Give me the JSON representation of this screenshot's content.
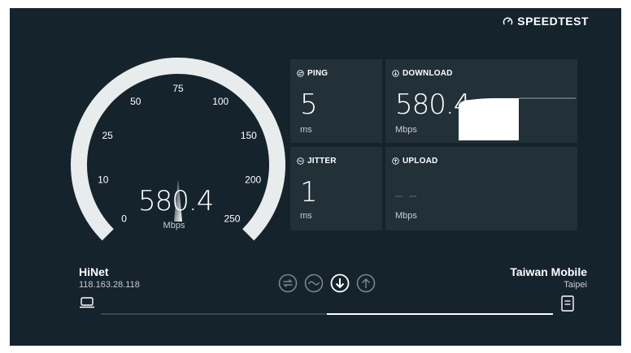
{
  "brand": {
    "name": "SPEEDTEST",
    "icon": "speedometer-icon"
  },
  "gauge": {
    "ticks": [
      "0",
      "10",
      "25",
      "50",
      "75",
      "100",
      "150",
      "200",
      "250"
    ],
    "needle_value": 75,
    "value": "580.4",
    "unit": "Mbps"
  },
  "ping": {
    "label": "PING",
    "value": "5",
    "unit": "ms",
    "icon": "ping-icon"
  },
  "jitter": {
    "label": "JITTER",
    "value": "1",
    "unit": "ms",
    "icon": "jitter-icon"
  },
  "download": {
    "label": "DOWNLOAD",
    "value": "580.4",
    "unit": "Mbps",
    "icon": "download-icon"
  },
  "upload": {
    "label": "UPLOAD",
    "value": "– –",
    "unit": "Mbps",
    "icon": "upload-icon"
  },
  "isp": {
    "name": "HiNet",
    "ip": "118.163.28.118"
  },
  "server": {
    "name": "Taiwan Mobile",
    "location": "Taipei"
  },
  "phases": [
    "ping-icon",
    "jitter-icon",
    "download-icon",
    "upload-icon"
  ],
  "progress": {
    "fraction": 0.5
  },
  "colors": {
    "background": "#15232d",
    "card": "#223038",
    "accent": "#ffffff"
  }
}
